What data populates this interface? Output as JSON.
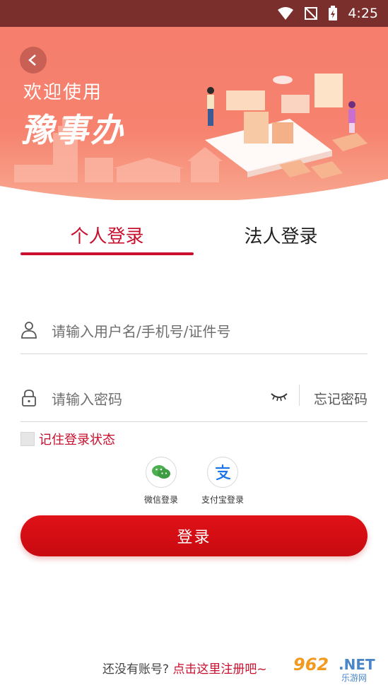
{
  "status_bar": {
    "time": "4:25"
  },
  "hero": {
    "welcome": "欢迎使用",
    "brand": "豫事办"
  },
  "tabs": [
    {
      "label": "个人登录",
      "active": true
    },
    {
      "label": "法人登录",
      "active": false
    }
  ],
  "username_field": {
    "placeholder": "请输入用户名/手机号/证件号",
    "value": ""
  },
  "password_field": {
    "placeholder": "请输入密码",
    "value": ""
  },
  "forgot_label": "忘记密码",
  "remember": {
    "label": "记住登录状态",
    "checked": false
  },
  "social": [
    {
      "label": "微信登录",
      "icon": "wechat-icon"
    },
    {
      "label": "支付宝登录",
      "icon": "alipay-icon"
    }
  ],
  "login_label": "登录",
  "register": {
    "prompt": "还没有账号?",
    "link": "点击这里注册吧~"
  },
  "watermark": {
    "num": "962",
    "net": ".NET",
    "sub": "乐游网"
  },
  "colors": {
    "accent": "#c8102e",
    "hero": "#f57d6c",
    "button": "#d60f16"
  }
}
